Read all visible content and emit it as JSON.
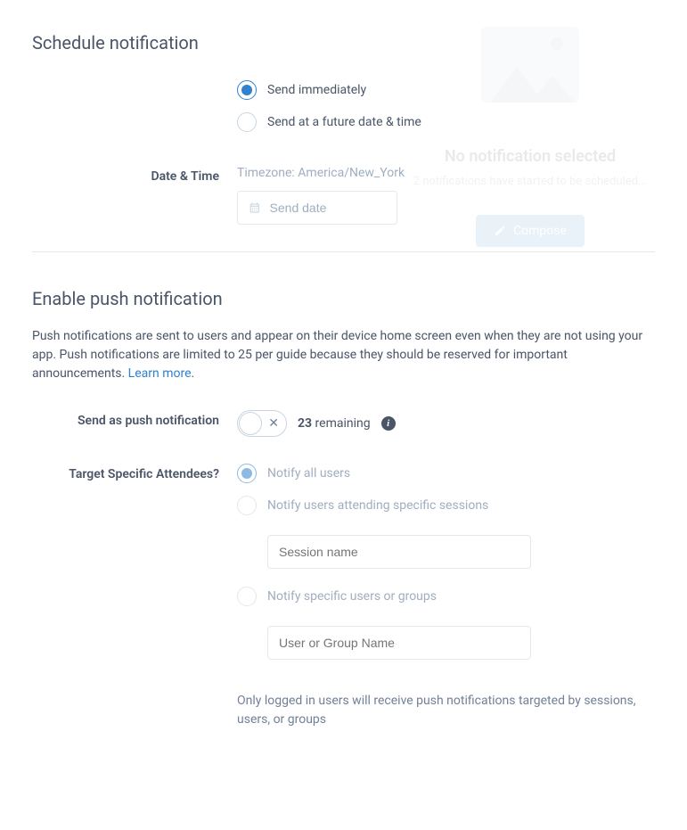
{
  "schedule": {
    "title": "Schedule notification",
    "options": {
      "immediate": "Send immediately",
      "future": "Send at a future date & time"
    },
    "datetime_label": "Date & Time",
    "timezone": "Timezone: America/New_York",
    "send_date_placeholder": "Send date"
  },
  "push": {
    "title": "Enable push notification",
    "description_start": "Push notifications are sent to users and appear on their device home screen even when they are not using your app. Push notifications are limited to 25 per guide because they should be reserved for important announcements. ",
    "learn_more": "Learn more",
    "send_as_label": "Send as push notification",
    "remaining_count": "23",
    "remaining_label": " remaining",
    "target_label": "Target Specific Attendees?",
    "options": {
      "all": "Notify all users",
      "sessions": "Notify users attending specific sessions",
      "users": "Notify specific users or groups"
    },
    "session_placeholder": "Session name",
    "user_placeholder": "User or Group Name",
    "note": "Only logged in users will receive push notifications targeted by sessions, users, or groups"
  },
  "ghost": {
    "title": "No notification selected",
    "subtitle": "2 notifications have started to be scheduled...",
    "button": "Compose"
  }
}
